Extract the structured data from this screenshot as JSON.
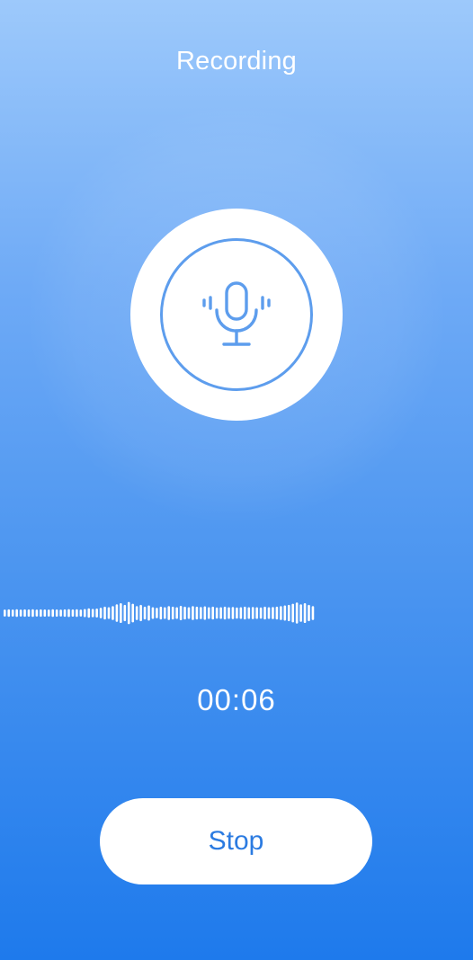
{
  "header": {
    "title": "Recording"
  },
  "recorder": {
    "icon": "microphone-icon",
    "accent_color": "#5d9ded",
    "elapsed": "00:06"
  },
  "waveform": {
    "levels": [
      0.3,
      0.32,
      0.3,
      0.33,
      0.3,
      0.32,
      0.31,
      0.33,
      0.3,
      0.32,
      0.31,
      0.3,
      0.33,
      0.31,
      0.3,
      0.32,
      0.34,
      0.31,
      0.33,
      0.3,
      0.35,
      0.4,
      0.36,
      0.38,
      0.45,
      0.55,
      0.5,
      0.6,
      0.75,
      0.85,
      0.7,
      0.95,
      0.8,
      0.6,
      0.7,
      0.55,
      0.65,
      0.5,
      0.45,
      0.55,
      0.5,
      0.6,
      0.55,
      0.5,
      0.62,
      0.55,
      0.5,
      0.6,
      0.55,
      0.52,
      0.58,
      0.5,
      0.55,
      0.48,
      0.5,
      0.55,
      0.5,
      0.52,
      0.48,
      0.5,
      0.55,
      0.5,
      0.52,
      0.5,
      0.48,
      0.55,
      0.5,
      0.52,
      0.55,
      0.6,
      0.65,
      0.7,
      0.8,
      0.9,
      0.75,
      0.85,
      0.7,
      0.6
    ]
  },
  "controls": {
    "stop_label": "Stop",
    "stop_text_color": "#2b7be1"
  }
}
